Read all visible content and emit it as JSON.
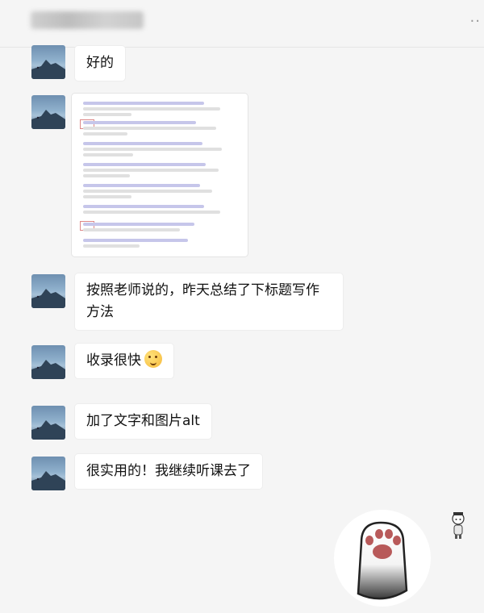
{
  "header": {
    "chat_title": "",
    "more_icon": "more-icon"
  },
  "messages": [
    {
      "type": "text",
      "text": "好的"
    },
    {
      "type": "image"
    },
    {
      "type": "text",
      "text": "按照老师说的，昨天总结了下标题写作\n方法"
    },
    {
      "type": "text",
      "text": "收录很快",
      "emoji": "thinking-face-icon"
    },
    {
      "type": "text",
      "text": "加了文字和图片alt"
    },
    {
      "type": "text",
      "text": "很实用的！我继续听课去了"
    },
    {
      "type": "sticker",
      "sticker": "cat-paw-sticker"
    }
  ],
  "colors": {
    "background": "#f5f5f5",
    "bubble": "#ffffff"
  }
}
